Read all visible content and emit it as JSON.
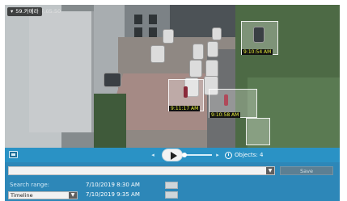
{
  "camera": {
    "label": "59.카메라"
  },
  "overlay_timestamp": "07:05:50",
  "detections": [
    {
      "time": "9:10:54 AM"
    },
    {
      "time": "9:11:17 AM"
    },
    {
      "time": "9:10:58 AM"
    }
  ],
  "controls": {
    "prev_icon": "◂",
    "next_icon": "▸",
    "objects_label": "Objects: 4"
  },
  "panel": {
    "save_label": "Save",
    "search_range_label": "Search range:",
    "start_datetime": "7/10/2019 8:30 AM",
    "end_datetime": "7/10/2019 9:35 AM",
    "mode_select": "Timeline"
  },
  "icons": {
    "camera": "camera-icon",
    "play": "play-icon",
    "clock": "clock-icon",
    "dropdown": "chevron-down-icon"
  },
  "colors": {
    "control_bar": "#2a92c5",
    "panel": "#2d87b8",
    "detection_label_text": "#e8f03a"
  }
}
